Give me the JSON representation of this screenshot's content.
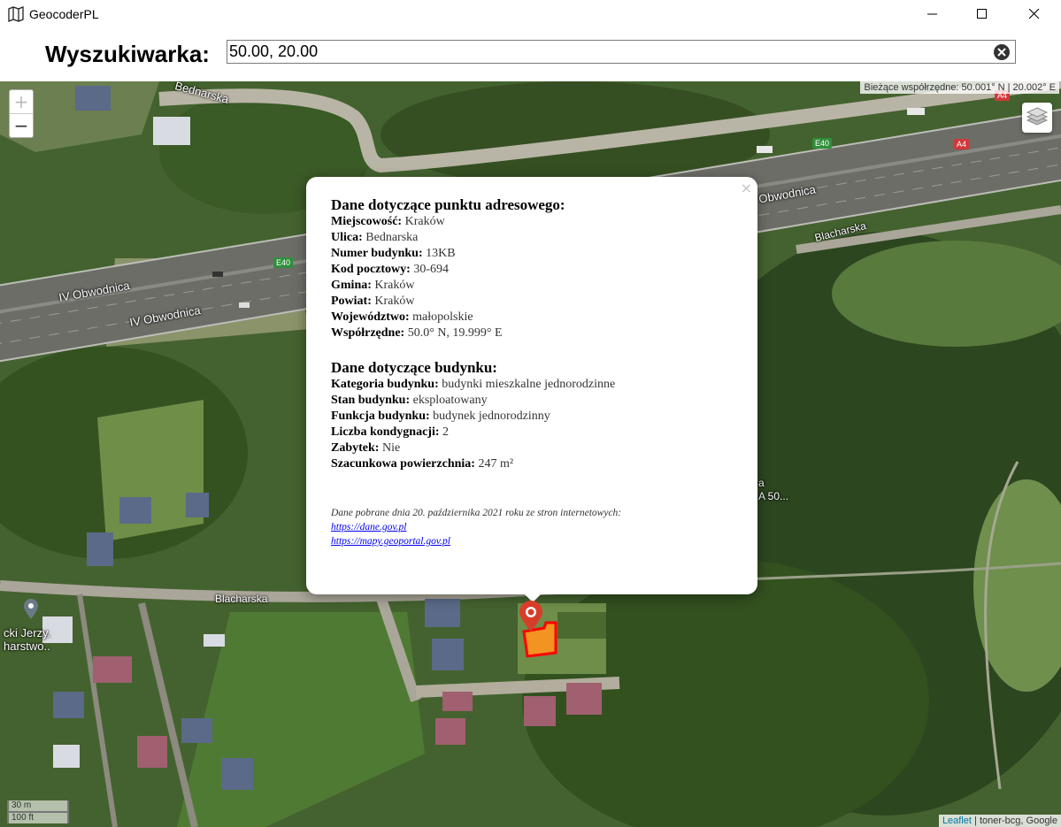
{
  "window": {
    "title": "GeocoderPL",
    "minimize_icon": "minimize-icon",
    "maximize_icon": "maximize-icon",
    "close_icon": "close-icon"
  },
  "search": {
    "label": "Wyszukiwarka:",
    "value": "50.00, 20.00",
    "clear_icon": "clear-icon"
  },
  "map": {
    "coords_readout": "Bieżące współrzędne: 50.001° N | 20.002° E",
    "zoom_in": "+",
    "zoom_out": "−",
    "layers_icon": "layers-icon",
    "scale_metric": "30 m",
    "scale_imperial": "100 ft",
    "attribution_link": "Leaflet",
    "attribution_rest": " | toner-bcg, Google",
    "labels": {
      "bednarska": "Bednarska",
      "obwodnica1": "IV Obwodnica",
      "obwodnica2": "IV Obwodnica",
      "obwodnica3": "Obwodnica",
      "blacharska1": "Blacharska",
      "blacharska2": "Blacharska",
      "poi1": "cki Jerzy.",
      "poi2": "harstwo..",
      "poi3": "a",
      "poi4": "A 50..."
    },
    "shields": {
      "e40a": "E40",
      "e40b": "E40",
      "a4": "A4",
      "a4b": "A4"
    },
    "colors": {
      "shield_green": "#2f8f3a",
      "shield_red": "#d0393a",
      "marker_red": "#d63e2a",
      "building_fill": "#f29322",
      "building_stroke": "#ff0000"
    }
  },
  "popup": {
    "close": "×",
    "heading1": "Dane dotyczące punktu adresowego:",
    "address": [
      {
        "k": "Miejscowość:",
        "v": " Kraków"
      },
      {
        "k": "Ulica:",
        "v": " Bednarska"
      },
      {
        "k": "Numer budynku:",
        "v": " 13KB"
      },
      {
        "k": "Kod pocztowy:",
        "v": " 30-694"
      },
      {
        "k": "Gmina:",
        "v": " Kraków"
      },
      {
        "k": "Powiat:",
        "v": " Kraków"
      },
      {
        "k": "Województwo:",
        "v": " małopolskie"
      },
      {
        "k": "Współrzędne:",
        "v": " 50.0° N, 19.999° E"
      }
    ],
    "heading2": "Dane dotyczące budynku:",
    "building": [
      {
        "k": "Kategoria budynku:",
        "v": " budynki mieszkalne jednorodzinne"
      },
      {
        "k": "Stan budynku:",
        "v": " eksploatowany"
      },
      {
        "k": "Funkcja budynku:",
        "v": " budynek jednorodzinny"
      },
      {
        "k": "Liczba kondygnacji:",
        "v": " 2"
      },
      {
        "k": "Zabytek:",
        "v": " Nie"
      },
      {
        "k": "Szacunkowa powierzchnia:",
        "v": " 247 m²"
      }
    ],
    "source_text": "Dane pobrane dnia 20. października 2021 roku ze stron internetowych:",
    "source_link1": "https://dane.gov.pl",
    "source_link2": "https://mapy.geoportal.gov.pl"
  }
}
